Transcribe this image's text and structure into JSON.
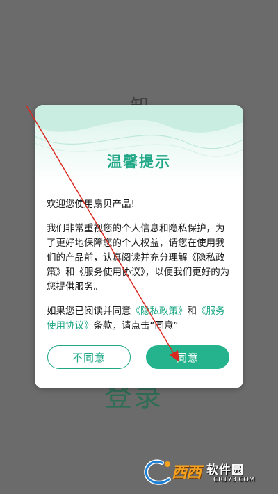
{
  "background": {
    "partial_top_char": "知",
    "partial_bottom_text": "登录"
  },
  "dialog": {
    "title": "温馨提示",
    "welcome": "欢迎您使用扇贝产品!",
    "paragraph": "我们非常重视您的个人信息和隐私保护，为了更好地保障您的个人权益，请您在使用我们的产品前，认真阅读并充分理解《隐私政策》和《服务使用协议》，以便我们更好的为您提供服务。",
    "consent_prefix": "如果您已阅读并同意",
    "privacy_link": "《隐私政策》",
    "consent_and": "和",
    "terms_link": "《服务使用协议》",
    "consent_suffix": "条款，请点击“同意”",
    "disagree_label": "不同意",
    "agree_label": "同意"
  },
  "colors": {
    "accent": "#1fa786",
    "button_fill": "#25b38d",
    "overlay": "#6b6b6b",
    "annotation": "#d9281e"
  },
  "watermark": {
    "brand": "西西",
    "title": "软件园",
    "url": "CR173.COM"
  }
}
